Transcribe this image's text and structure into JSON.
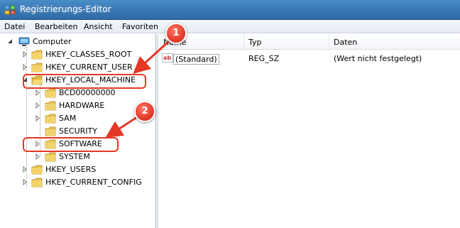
{
  "window": {
    "title": "Registrierungs-Editor",
    "icon": "registry-editor-icon"
  },
  "menu": [
    "Datei",
    "Bearbeiten",
    "Ansicht",
    "Favoriten"
  ],
  "tree": {
    "root": "Computer",
    "hives": {
      "hkcr": "HKEY_CLASSES_ROOT",
      "hkcu": "HKEY_CURRENT_USER",
      "hklm": "HKEY_LOCAL_MACHINE",
      "hku": "HKEY_USERS",
      "hkcc": "HKEY_CURRENT_CONFIG"
    },
    "hklm_children": {
      "bcd": "BCD00000000",
      "hardware": "HARDWARE",
      "sam": "SAM",
      "security": "SECURITY",
      "software": "SOFTWARE",
      "system": "SYSTEM"
    }
  },
  "list": {
    "columns": {
      "name": "Name",
      "type": "Typ",
      "data": "Daten"
    },
    "rows": [
      {
        "name": "(Standard)",
        "type": "REG_SZ",
        "data": "(Wert nicht festgelegt)"
      }
    ],
    "value_icon_text": "ab"
  },
  "callouts": {
    "one": "1",
    "two": "2"
  },
  "colors": {
    "callout_red": "#e53826",
    "title_blue": "#3b7ab5",
    "folder_yellow": "#e9c14f"
  }
}
